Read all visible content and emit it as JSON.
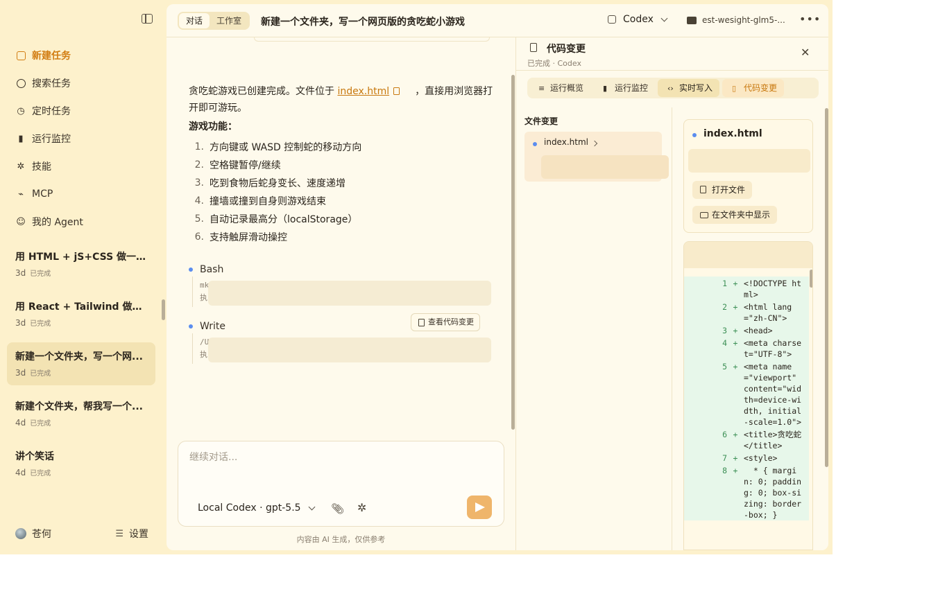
{
  "colors": {
    "accent": "#d27d12",
    "sidebar_bg": "#fdf1cc",
    "panel_bg": "#fefaec",
    "diff_add": "#e7f7ea",
    "dot_blue": "#5b8def",
    "send_button": "#efb56b"
  },
  "sidebar": {
    "toggle_icon": "sidebar-toggle-icon",
    "nav": [
      {
        "label": "新建任务",
        "icon": "edit-icon"
      },
      {
        "label": "搜索任务",
        "icon": "search-icon"
      },
      {
        "label": "定时任务",
        "icon": "clock-icon"
      },
      {
        "label": "运行监控",
        "icon": "bar-chart-icon"
      },
      {
        "label": "技能",
        "icon": "puzzle-icon"
      },
      {
        "label": "MCP",
        "icon": "mcp-icon"
      },
      {
        "label": "我的 Agent",
        "icon": "agent-icon"
      }
    ],
    "tasks": [
      {
        "title": "用 HTML + jS+CSS 做一个 ...",
        "age": "3d",
        "status": "已完成"
      },
      {
        "title": "用 React + Tailwind 做一个 ...",
        "age": "3d",
        "status": "已完成"
      },
      {
        "title": "新建一个文件夹，写一个网...",
        "age": "3d",
        "status": "已完成"
      },
      {
        "title": "新建个文件夹，帮我写一个...",
        "age": "4d",
        "status": "已完成"
      },
      {
        "title": "讲个笑话",
        "age": "4d",
        "status": "已完成"
      }
    ],
    "user": "苍何",
    "settings": "设置"
  },
  "topbar": {
    "tabs": [
      "对话",
      "工作室"
    ],
    "title": "新建一个文件夹，写一个网页版的贪吃蛇小游戏",
    "agent": "Codex",
    "folder": "est-wesight-glm5-..."
  },
  "chat": {
    "intro_before": "贪吃蛇游戏已创建完成。文件位于 ",
    "intro_link": "index.html",
    "intro_after": "，直接用浏览器打开即可游玩。",
    "features_title": "游戏功能：",
    "features": [
      "方向键或 WASD 控制蛇的移动方向",
      "空格键暂停/继续",
      "吃到食物后蛇身变长、速度递增",
      "撞墙或撞到自身则游戏结束",
      "自动记录最高分（localStorage）",
      "支持触屏滑动操控"
    ],
    "tools": [
      {
        "name": "Bash",
        "line1": "mk",
        "line2": "执"
      },
      {
        "name": "Write",
        "line1": "/U",
        "line2": "执"
      }
    ],
    "view_changes": "查看代码变更",
    "composer_placeholder": "继续对话...",
    "model": "Local Codex · gpt-5.5",
    "disclaimer": "内容由 AI 生成，仅供参考"
  },
  "panel": {
    "title": "代码变更",
    "subtitle": "已完成 · Codex",
    "tabs": [
      "运行概览",
      "运行监控",
      "实时写入",
      "代码变更"
    ],
    "file_changes_title": "文件变更",
    "file_name": "index.html",
    "card_name": "index.html",
    "open_file": "打开文件",
    "show_in_folder": "在文件夹中显示",
    "diff": [
      {
        "ln": "1",
        "code": "<!DOCTYPE html>"
      },
      {
        "ln": "2",
        "code": "<html lang=\"zh-CN\">"
      },
      {
        "ln": "3",
        "code": "<head>"
      },
      {
        "ln": "4",
        "code": "<meta charset=\"UTF-8\">"
      },
      {
        "ln": "5",
        "code": "<meta name=\"viewport\" content=\"width=device-width, initial-scale=1.0\">"
      },
      {
        "ln": "6",
        "code": "<title>贪吃蛇</title>"
      },
      {
        "ln": "7",
        "code": "<style>"
      },
      {
        "ln": "8",
        "code": "  * { margin: 0; padding: 0; box-sizing: border-box; }"
      }
    ]
  }
}
